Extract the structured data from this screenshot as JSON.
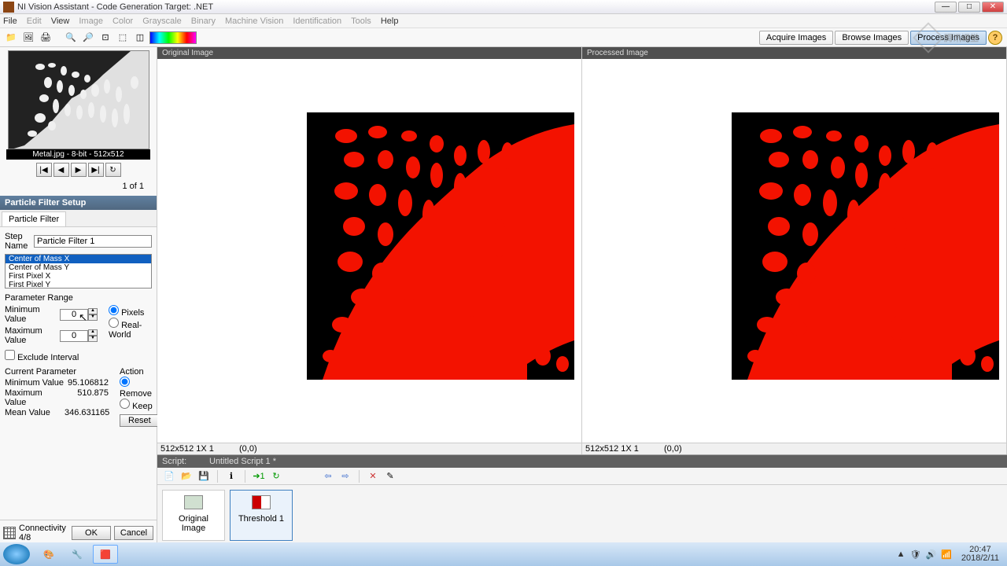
{
  "window": {
    "title": "NI Vision Assistant - Code Generation Target: .NET"
  },
  "menu": [
    "File",
    "Edit",
    "View",
    "Image",
    "Color",
    "Grayscale",
    "Binary",
    "Machine Vision",
    "Identification",
    "Tools",
    "Help"
  ],
  "menu_dim": [
    false,
    true,
    false,
    true,
    true,
    true,
    true,
    true,
    true,
    true,
    false
  ],
  "modes": {
    "acquire": "Acquire Images",
    "browse": "Browse Images",
    "process": "Process Images"
  },
  "thumb": {
    "caption": "Metal.jpg - 8-bit - 512x512",
    "page": "1  of  1"
  },
  "panel": {
    "title": "Particle Filter Setup",
    "tab": "Particle Filter",
    "step_label": "Step Name",
    "step_value": "Particle Filter 1",
    "list": [
      "Center of Mass X",
      "Center of Mass Y",
      "First Pixel X",
      "First Pixel Y"
    ],
    "param_range": "Parameter Range",
    "min_label": "Minimum Value",
    "min_val": "0",
    "max_label": "Maximum Value",
    "max_val": "0",
    "pixels": "Pixels",
    "realworld": "Real-World",
    "exclude": "Exclude Interval",
    "current": "Current Parameter",
    "cp_min_l": "Minimum Value",
    "cp_min_v": "95.106812",
    "cp_max_l": "Maximum Value",
    "cp_max_v": "510.875",
    "cp_mean_l": "Mean Value",
    "cp_mean_v": "346.631165",
    "action": "Action",
    "remove": "Remove",
    "keep": "Keep",
    "reset": "Reset",
    "conn": "Connectivity 4/8",
    "ok": "OK",
    "cancel": "Cancel"
  },
  "views": {
    "original": "Original Image",
    "processed": "Processed Image",
    "status_l": "512x512 1X 1",
    "status_r": "(0,0)"
  },
  "script": {
    "label": "Script:",
    "name": "Untitled Script 1 *",
    "step1": "Original Image",
    "step2": "Threshold 1"
  },
  "tray": {
    "time": "20:47",
    "date": "2018/2/11"
  },
  "watermark": "腾讯课堂",
  "chart_data": {
    "type": "image-processing",
    "image": "Metal.jpg",
    "dims": [
      512,
      512
    ],
    "depth": "8-bit",
    "filter": "Particle Filter",
    "parameter": "Center of Mass X",
    "range": {
      "min": 0,
      "max": 0,
      "unit": "Pixels",
      "exclude": false
    },
    "stats": {
      "min": 95.106812,
      "max": 510.875,
      "mean": 346.631165
    },
    "action": "Remove",
    "connectivity": "4/8"
  }
}
